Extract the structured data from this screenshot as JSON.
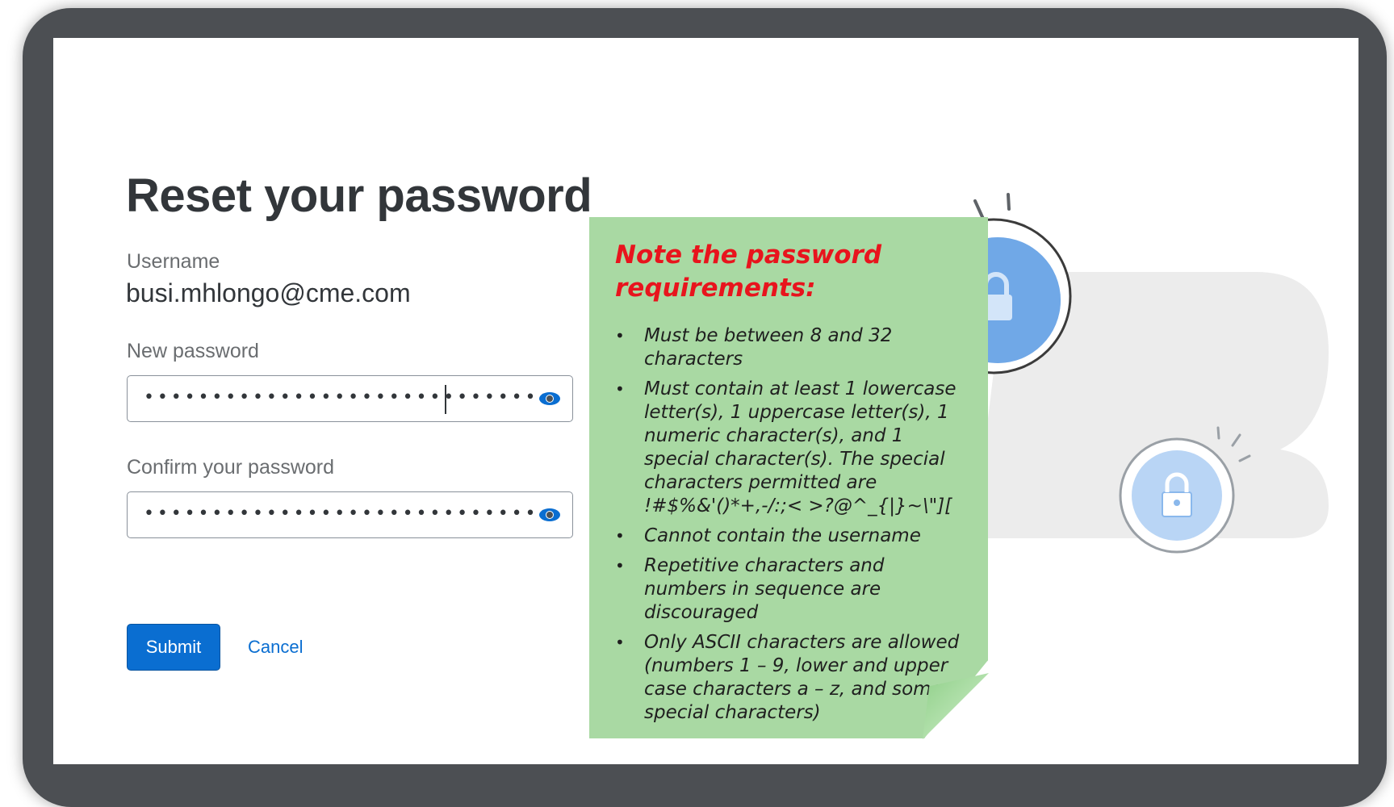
{
  "page": {
    "title": "Reset your password"
  },
  "form": {
    "username_label": "Username",
    "username_value": "busi.mhlongo@cme.com",
    "new_password_label": "New password",
    "new_password_value": "••••••••••••••••••••••••••••••",
    "confirm_password_label": "Confirm your password",
    "confirm_password_value": "••••••••••••••••••••••••••••••",
    "submit_label": "Submit",
    "cancel_label": "Cancel"
  },
  "note": {
    "title": "Note the password requirements:",
    "bullet_symbol": "•",
    "items": [
      "Must be between 8 and 32 characters",
      "Must contain at least 1 lowercase letter(s), 1 uppercase letter(s), 1 numeric character(s), and 1 special character(s). The special characters permitted are !#$%&'()*+,-/:;< >?@^_{|}~\\\"][",
      "Cannot contain the username",
      "Repetitive characters and numbers in sequence are discouraged",
      "Only ASCII characters are allowed (numbers 1 – 9, lower and upper case characters a – z, and some special characters)"
    ]
  },
  "colors": {
    "accent": "#0a6ed1",
    "note_background": "#a9d9a3",
    "note_title": "#e8141d",
    "frame": "#4c4f53"
  },
  "icons": {
    "password_reveal": "eye-icon",
    "illustration_lock": "lock-icon"
  }
}
